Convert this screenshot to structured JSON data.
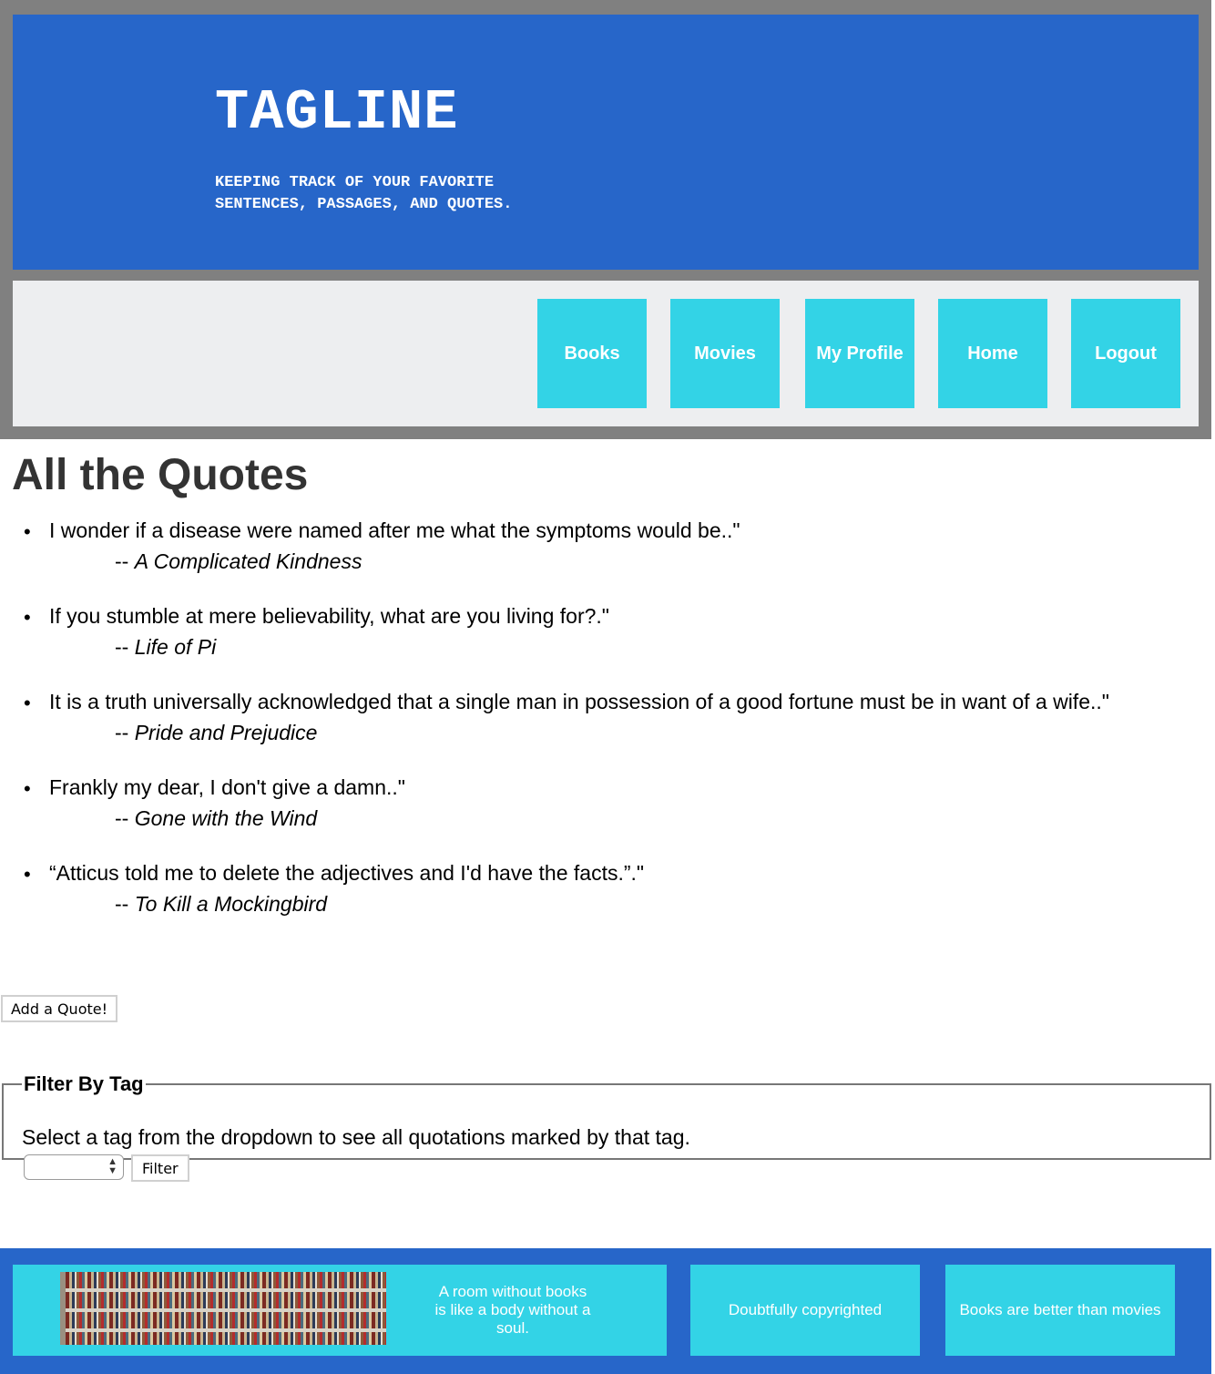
{
  "header": {
    "title": "TAGLINE",
    "subtitle": "KEEPING TRACK OF YOUR FAVORITE SENTENCES, PASSAGES, AND QUOTES."
  },
  "nav": {
    "items": [
      "Books",
      "Movies",
      "My Profile",
      "Home",
      "Logout"
    ]
  },
  "main": {
    "title": "All the Quotes",
    "quotes": [
      {
        "text": "I wonder if a disease were named after me what the symptoms would be..\"",
        "source": "A Complicated Kindness"
      },
      {
        "text": "If you stumble at mere believability, what are you living for?.\"",
        "source": "Life of Pi"
      },
      {
        "text": "It is a truth universally acknowledged that a single man in possession of a good fortune must be in want of a wife..\"",
        "source": "Pride and Prejudice"
      },
      {
        "text": "Frankly my dear, I don't give a damn..\"",
        "source": "Gone with the Wind"
      },
      {
        "text": "“Atticus told me to delete the adjectives and I'd have the facts.”.\"",
        "source": "To Kill a Mockingbird"
      }
    ],
    "source_prefix": "-- ",
    "add_button": "Add a Quote!"
  },
  "filter": {
    "legend": "Filter By Tag",
    "hint": "Select a tag from the dropdown to see all quotations marked by that tag.",
    "selected": "",
    "button": "Filter"
  },
  "footer": {
    "quote": "A room without books is like a body without a soul.",
    "copyright": "Doubtfully copyrighted",
    "motto": "Books are better than movies"
  },
  "colors": {
    "banner_blue": "#2766c9",
    "nav_cyan": "#33d3e6",
    "frame_gray": "#808080",
    "nav_bg": "#edeef0"
  }
}
